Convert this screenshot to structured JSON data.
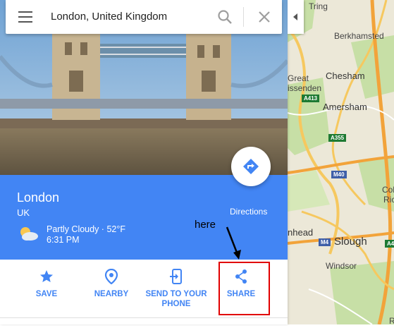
{
  "search": {
    "value": "London, United Kingdom"
  },
  "place": {
    "name": "London",
    "country": "UK",
    "weather": "Partly Cloudy · 52°F",
    "time": "6:31 PM"
  },
  "directions": {
    "label": "Directions"
  },
  "actions": [
    {
      "label": "SAVE",
      "icon": "star-icon"
    },
    {
      "label": "NEARBY",
      "icon": "place-pin-icon"
    },
    {
      "label": "SEND TO YOUR PHONE",
      "label_line1": "SEND TO YOUR",
      "label_line2": "PHONE",
      "icon": "send-to-phone-icon"
    },
    {
      "label": "SHARE",
      "icon": "share-icon"
    }
  ],
  "annotation": {
    "text": "here",
    "color": "#e10000"
  },
  "map": {
    "labels": {
      "tring": "Tring",
      "berkhamsted": "Berkhamsted",
      "great": "Great",
      "missenden": "issenden",
      "chesham": "Chesham",
      "amersham": "Amersham",
      "head": "nhead",
      "slough": "Slough",
      "windsor": "Windsor",
      "col": "Col",
      "ric": "Ric",
      "r": "R"
    },
    "road_shields": {
      "a413": "A413",
      "a355": "A355",
      "m40": "M40",
      "m4": "M4",
      "a4": "A4"
    }
  },
  "colors": {
    "accent": "#4285f4",
    "road": "#f6c85f",
    "motorway": "#f2a33a",
    "green": "#c7dfa6"
  }
}
